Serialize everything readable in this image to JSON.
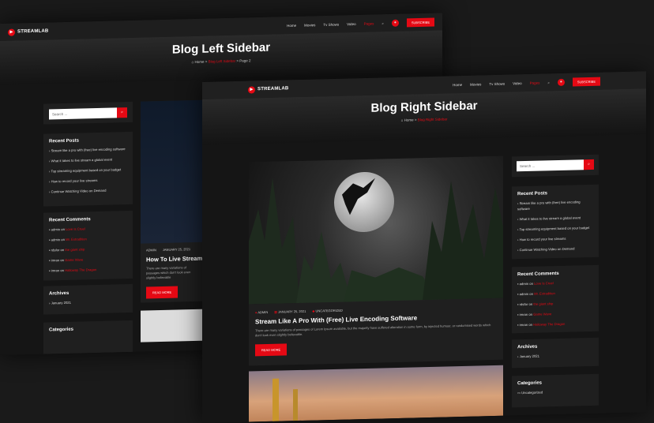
{
  "brand": "STREAMLAB",
  "nav": [
    "Home",
    "Movies",
    "Tv Shows",
    "Video",
    "Pages"
  ],
  "subscribe": "SUBSCRIBE",
  "search_placeholder": "Search ...",
  "back": {
    "title": "Blog Left Sidebar",
    "crumb_home": "Home",
    "crumb_mid": "Blog Left Sidebar",
    "crumb_end": "Page 2",
    "post_title": "How To Live Stream",
    "post_excerpt": "There are many variations of passages which don't look even slightly believable"
  },
  "front": {
    "title": "Blog Right Sidebar",
    "crumb_home": "Home",
    "crumb_end": "Blog Right Sidebar"
  },
  "recent_posts_title": "Recent Posts",
  "recent_posts": [
    "Stream like a pro with (free) live encoding software",
    "What it takes to live stream a global event",
    "Top streaming equipment based on your budget",
    "How to record your live streams",
    "Continue Watching Video on Demand"
  ],
  "recent_comments_title": "Recent Comments",
  "comments": [
    {
      "author": "admin",
      "post": "Love Is Cruel"
    },
    {
      "author": "admin",
      "post": "Mr. Extradition"
    },
    {
      "author": "rdsfor",
      "post": "the giant ship"
    },
    {
      "author": "imran",
      "post": "Game Wave"
    },
    {
      "author": "imran",
      "post": "Halloway The Dragon"
    }
  ],
  "on": "on",
  "archives_title": "Archives",
  "archive": "January 2021",
  "categories_title": "Categories",
  "category": "Uncategorized",
  "post": {
    "author": "ADMIN",
    "date": "JANUARY 25, 2021",
    "category": "UNCATEGORIZED",
    "title": "Stream Like A Pro With (Free) Live Encoding Software",
    "excerpt": "There are many variations of passages of Lorem Ipsum available, but the majority have suffered alteration in some form, by injected humour, or randomised words which don't look even slightly believable.",
    "read_more": "READ MORE"
  },
  "colors": {
    "accent": "#e50914",
    "bg": "#151515",
    "card": "#1f1f1f"
  }
}
